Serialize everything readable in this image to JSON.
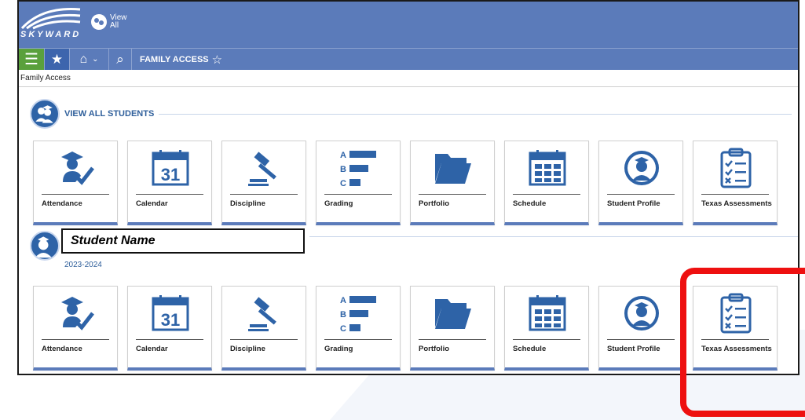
{
  "app": {
    "logo_text": "SKYWARD",
    "view_all": "View All"
  },
  "navbar": {
    "menu_icon": "hamburger-icon",
    "title": "FAMILY ACCESS",
    "fav_glyph": "☆"
  },
  "breadcrumb": "Family Access",
  "all_students": {
    "header": "VIEW ALL STUDENTS"
  },
  "tiles": [
    {
      "label": "Attendance",
      "icon": "attendance-icon"
    },
    {
      "label": "Calendar",
      "icon": "calendar-icon",
      "day": "31"
    },
    {
      "label": "Discipline",
      "icon": "gavel-icon"
    },
    {
      "label": "Grading",
      "icon": "grading-icon",
      "letters": [
        "A",
        "B",
        "C"
      ]
    },
    {
      "label": "Portfolio",
      "icon": "folder-icon"
    },
    {
      "label": "Schedule",
      "icon": "schedule-icon"
    },
    {
      "label": "Student Profile",
      "icon": "student-profile-icon"
    },
    {
      "label": "Texas Assessments",
      "icon": "checklist-icon"
    }
  ],
  "student": {
    "name": "Student Name",
    "year": "2023-2024"
  },
  "colors": {
    "brand": "#5b7bba",
    "icon": "#2e63a7",
    "highlight": "#ee1010",
    "green": "#5aa03c"
  }
}
